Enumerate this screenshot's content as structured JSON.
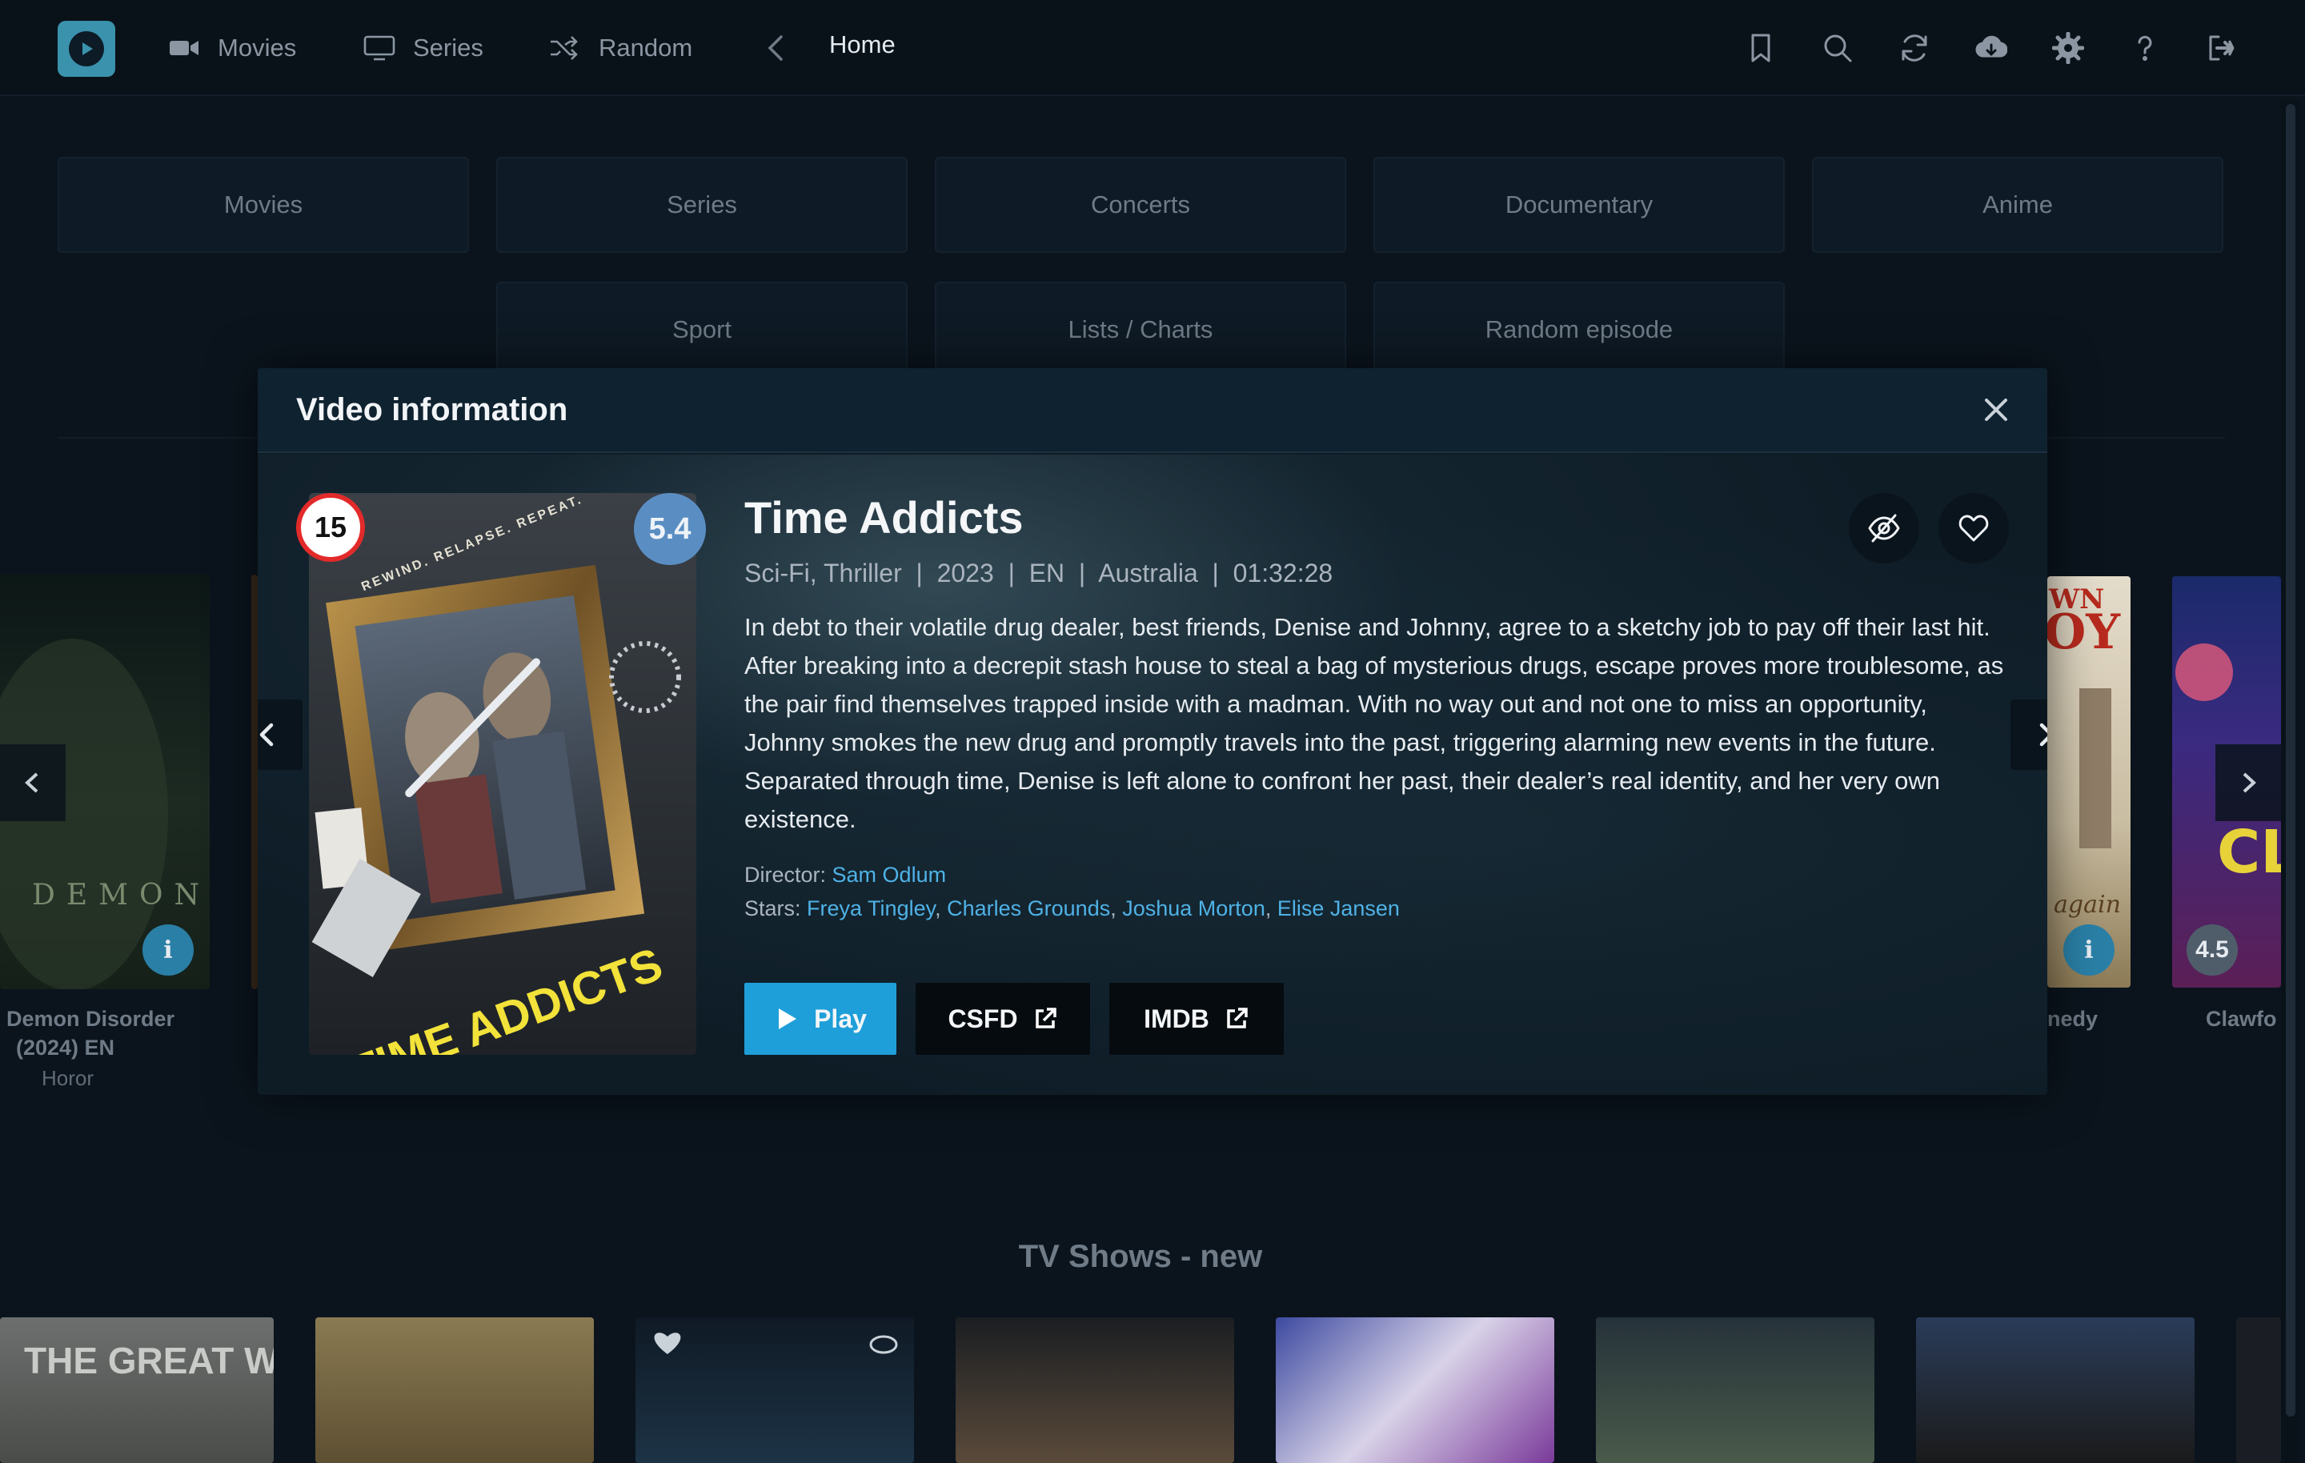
{
  "nav": {
    "items": [
      {
        "label": "Movies",
        "icon": "video-camera-icon"
      },
      {
        "label": "Series",
        "icon": "monitor-icon"
      },
      {
        "label": "Random",
        "icon": "shuffle-icon"
      }
    ],
    "breadcrumb": "Home",
    "right_icons": [
      "bookmark-icon",
      "search-icon",
      "refresh-icon",
      "cloud-download-icon",
      "gear-icon",
      "help-icon",
      "logout-icon"
    ]
  },
  "categories": [
    {
      "label": "Movies"
    },
    {
      "label": "Series"
    },
    {
      "label": "Concerts"
    },
    {
      "label": "Documentary"
    },
    {
      "label": "Anime"
    },
    {
      "label": "Sport"
    },
    {
      "label": "Lists / Charts"
    },
    {
      "label": "Random episode"
    }
  ],
  "background": {
    "left_card": {
      "title_line1": "Demon Disorder",
      "title_line2": "(2024) EN",
      "genre": "Horor",
      "info_glyph": "i"
    },
    "right_card": {
      "title_partial": "nedy",
      "info_glyph": "i"
    },
    "far_right_card": {
      "title_partial": "Clawfo",
      "score": "4.5"
    },
    "section_title": "TV Shows - new"
  },
  "modal": {
    "title": "Video information",
    "age_rating": "15",
    "score": "5.4",
    "movie_title": "Time Addicts",
    "meta": "Sci-Fi, Thriller  |  2023  |  EN  |  Australia  |  01:32:28",
    "description": "In debt to their volatile drug dealer, best friends, Denise and Johnny, agree to a sketchy job to pay off their last hit. After breaking into a decrepit stash house to steal a bag of mysterious drugs, escape proves more troublesome, as the pair find themselves trapped inside with a madman. With no way out and not one to miss an opportunity, Johnny smokes the new drug and promptly travels into the past, triggering alarming new events in the future. Separated through time, Denise is left alone to confront her past, their dealer’s real identity, and her very own existence.",
    "director_label": "Director: ",
    "director": "Sam Odlum",
    "stars_label": "Stars: ",
    "stars": [
      "Freya Tingley",
      "Charles Grounds",
      "Joshua Morton",
      "Elise Jansen"
    ],
    "poster": {
      "tagline": "REWIND. RELAPSE. REPEAT.",
      "title": "TIME ADDICTS"
    },
    "buttons": {
      "play": "Play",
      "csfd": "CSFD",
      "imdb": "IMDB"
    }
  },
  "colors": {
    "accent": "#1e9fd9",
    "link": "#4fb2e6",
    "score_bg": "#5a8ec3",
    "age_border": "#e32a2a"
  }
}
